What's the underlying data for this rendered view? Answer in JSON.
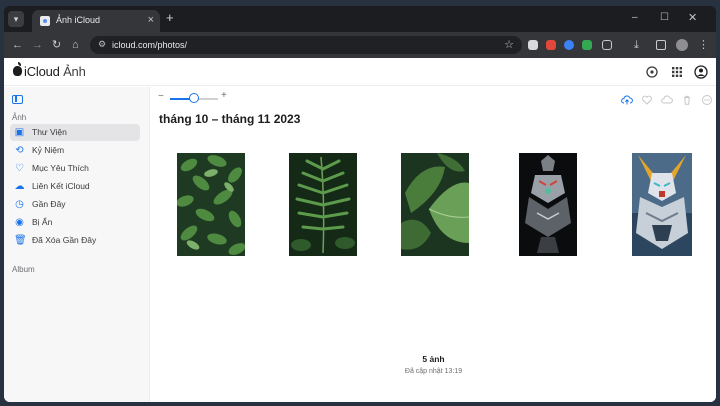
{
  "browser": {
    "tab_title": "Ảnh iCloud",
    "url": "icloud.com/photos/"
  },
  "app": {
    "brand": "iCloud",
    "product": "Ảnh"
  },
  "sidebar": {
    "section_photos": "Ảnh",
    "section_albums": "Album",
    "items": [
      {
        "label": "Thư Viện",
        "icon": "library-icon",
        "active": true
      },
      {
        "label": "Kỷ Niệm",
        "icon": "memories-icon",
        "active": false
      },
      {
        "label": "Mục Yêu Thích",
        "icon": "heart-icon",
        "active": false
      },
      {
        "label": "Liên Kết iCloud",
        "icon": "cloud-link-icon",
        "active": false
      },
      {
        "label": "Gần Đây",
        "icon": "clock-icon",
        "active": false
      },
      {
        "label": "Bị Ẩn",
        "icon": "eye-icon",
        "active": false
      },
      {
        "label": "Đã Xóa Gần Đây",
        "icon": "trash-icon",
        "active": false
      }
    ]
  },
  "library": {
    "date_range": "tháng 10 – tháng 11 2023",
    "zoom_level": 0.5,
    "photo_count": "5 ảnh",
    "updated": "Đã cập nhật 13:19",
    "photos": [
      {
        "name": "leaves-photo-1",
        "subject": "green leaves"
      },
      {
        "name": "fern-photo",
        "subject": "fern"
      },
      {
        "name": "large-leaves-photo",
        "subject": "large leaves"
      },
      {
        "name": "robot-photo",
        "subject": "mecha robot dark"
      },
      {
        "name": "gundam-photo",
        "subject": "gundam mecha"
      }
    ]
  },
  "colors": {
    "accent": "#1a73e8",
    "browser_dark": "#35363a"
  }
}
